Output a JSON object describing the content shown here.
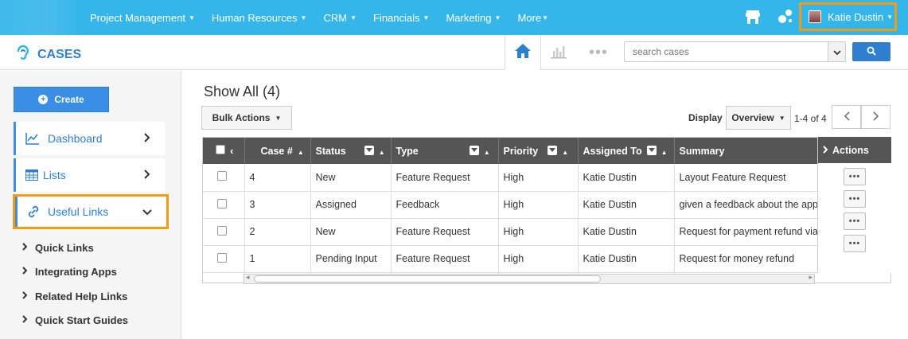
{
  "topnav": {
    "items": [
      {
        "label": "Project Management"
      },
      {
        "label": "Human Resources"
      },
      {
        "label": "CRM"
      },
      {
        "label": "Financials"
      },
      {
        "label": "Marketing"
      },
      {
        "label": "More"
      }
    ],
    "user": {
      "name": "Katie Dustin"
    }
  },
  "module": {
    "title": "CASES"
  },
  "search": {
    "placeholder": "search cases"
  },
  "sidebar": {
    "create_label": "Create",
    "cards": [
      {
        "label": "Dashboard"
      },
      {
        "label": "Lists"
      },
      {
        "label": "Useful Links"
      }
    ],
    "links": [
      {
        "label": "Quick Links"
      },
      {
        "label": "Integrating Apps"
      },
      {
        "label": "Related Help Links"
      },
      {
        "label": "Quick Start Guides"
      }
    ]
  },
  "main": {
    "title": "Show All (4)",
    "bulk_actions_label": "Bulk Actions",
    "display_label": "Display",
    "display_value": "Overview",
    "paging": "1-4 of 4"
  },
  "table": {
    "columns": [
      "Case #",
      "Status",
      "Type",
      "Priority",
      "Assigned To",
      "Summary"
    ],
    "actions_header": "Actions",
    "rows": [
      {
        "case": "4",
        "status": "New",
        "type": "Feature Request",
        "priority": "High",
        "assigned": "Katie Dustin",
        "summary": "Layout Feature Request"
      },
      {
        "case": "3",
        "status": "Assigned",
        "type": "Feedback",
        "priority": "High",
        "assigned": "Katie Dustin",
        "summary": "given a feedback about the app"
      },
      {
        "case": "2",
        "status": "New",
        "type": "Feature Request",
        "priority": "High",
        "assigned": "Katie Dustin",
        "summary": "Request for payment refund via l"
      },
      {
        "case": "1",
        "status": "Pending Input",
        "type": "Feature Request",
        "priority": "High",
        "assigned": "Katie Dustin",
        "summary": "Request for money refund"
      }
    ]
  },
  "colors": {
    "topbar": "#35b6ea",
    "accent": "#2f7fd1",
    "highlight": "#f39c12",
    "header": "#555555"
  }
}
